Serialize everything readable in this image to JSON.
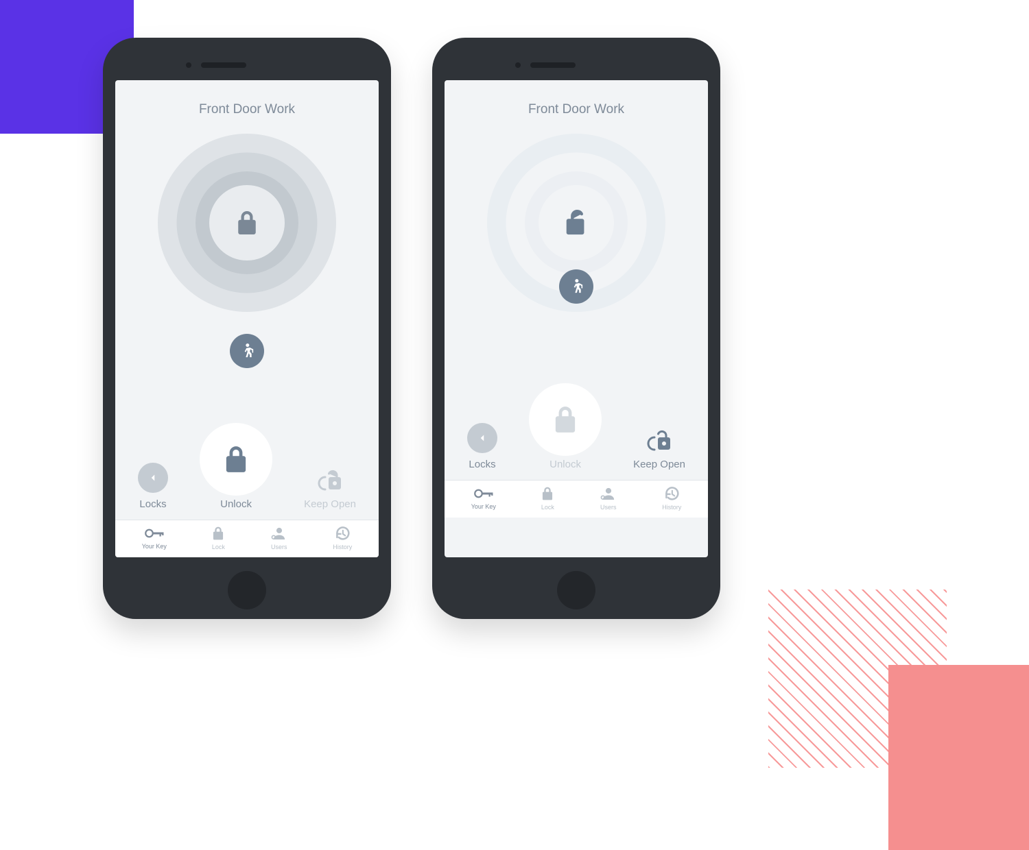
{
  "phones": [
    {
      "state": "locked",
      "title": "Front Door Work",
      "actions": {
        "back_label": "Locks",
        "center_label": "Unlock",
        "right_label": "Keep Open",
        "center_dim": false,
        "right_dim": true
      }
    },
    {
      "state": "unlocked",
      "title": "Front Door Work",
      "actions": {
        "back_label": "Locks",
        "center_label": "Unlock",
        "right_label": "Keep Open",
        "center_dim": true,
        "right_dim": false
      }
    }
  ],
  "nav": [
    {
      "label": "Your Key",
      "icon": "key-icon",
      "active": true
    },
    {
      "label": "Lock",
      "icon": "lock-icon",
      "active": false
    },
    {
      "label": "Users",
      "icon": "users-icon",
      "active": false
    },
    {
      "label": "History",
      "icon": "history-icon",
      "active": false
    }
  ],
  "colors": {
    "purple": "#5a32e6",
    "pink": "#f58f8f",
    "slate": "#6d7f92"
  }
}
